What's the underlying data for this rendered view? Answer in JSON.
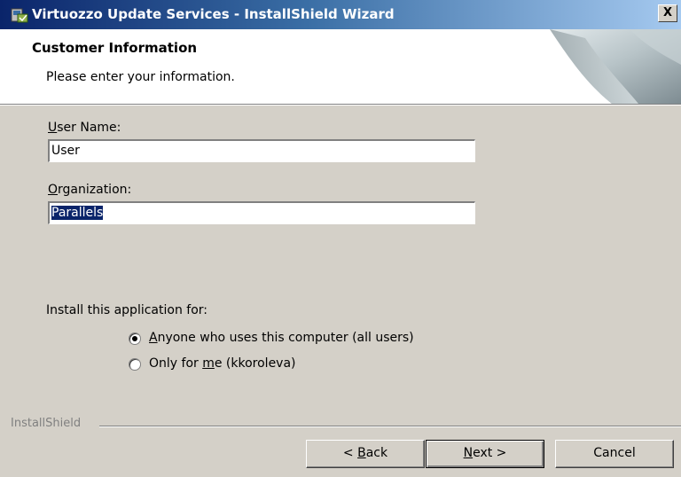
{
  "window": {
    "title": "Virtuozzo Update Services - InstallShield Wizard",
    "close_label": "X"
  },
  "header": {
    "title": "Customer Information",
    "subtitle": "Please enter your information."
  },
  "form": {
    "user_name": {
      "label_key": "U",
      "label_rest": "ser Name:",
      "value": "User"
    },
    "organization": {
      "label_key": "O",
      "label_rest": "rganization:",
      "value": "Parallels",
      "selected": true
    }
  },
  "install_for": {
    "label": "Install this application for:",
    "options": [
      {
        "key": "A",
        "rest": "nyone who uses this computer (all users)",
        "selected": true
      },
      {
        "pre": "Only for ",
        "key": "m",
        "rest": "e (kkoroleva)",
        "selected": false
      }
    ]
  },
  "footer": {
    "brand": "InstallShield",
    "back": {
      "pre": "< ",
      "key": "B",
      "rest": "ack"
    },
    "next": {
      "key": "N",
      "rest": "ext >"
    },
    "cancel": "Cancel"
  },
  "colors": {
    "title_start": "#0a246a",
    "title_end": "#a6caf0",
    "face": "#d4d0c8",
    "selection": "#0a246a"
  }
}
